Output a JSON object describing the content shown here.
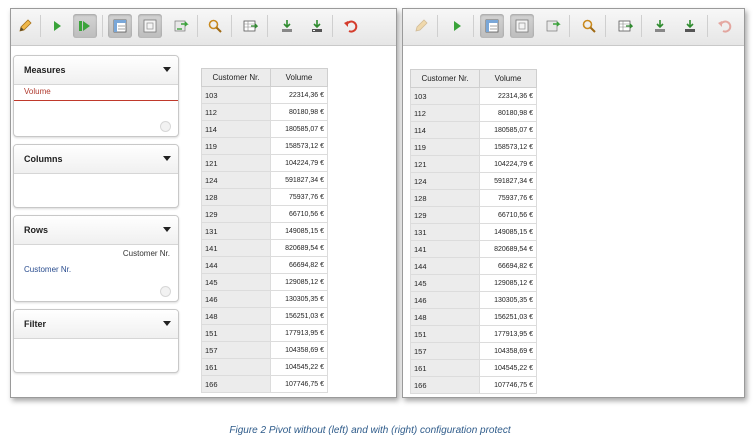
{
  "left_panel": {
    "sidebar": {
      "measures": {
        "title": "Measures",
        "items": [
          "Volume"
        ]
      },
      "columns": {
        "title": "Columns"
      },
      "rows": {
        "title": "Rows",
        "header_label": "Customer Nr.",
        "items": [
          "Customer Nr."
        ]
      },
      "filter": {
        "title": "Filter"
      }
    },
    "table": {
      "headers": [
        "Customer Nr.",
        "Volume"
      ],
      "rows": [
        [
          "103",
          "22314,36 €"
        ],
        [
          "112",
          "80180,98 €"
        ],
        [
          "114",
          "180585,07 €"
        ],
        [
          "119",
          "158573,12 €"
        ],
        [
          "121",
          "104224,79 €"
        ],
        [
          "124",
          "591827,34 €"
        ],
        [
          "128",
          "75937,76 €"
        ],
        [
          "129",
          "66710,56 €"
        ],
        [
          "131",
          "149085,15 €"
        ],
        [
          "141",
          "820689,54 €"
        ],
        [
          "144",
          "66694,82 €"
        ],
        [
          "145",
          "129085,12 €"
        ],
        [
          "146",
          "130305,35 €"
        ],
        [
          "148",
          "156251,03 €"
        ],
        [
          "151",
          "177913,95 €"
        ],
        [
          "157",
          "104358,69 €"
        ],
        [
          "161",
          "104545,22 €"
        ],
        [
          "166",
          "107746,75 €"
        ]
      ]
    }
  },
  "right_panel": {
    "table": {
      "headers": [
        "Customer Nr.",
        "Volume"
      ],
      "rows": [
        [
          "103",
          "22314,36 €"
        ],
        [
          "112",
          "80180,98 €"
        ],
        [
          "114",
          "180585,07 €"
        ],
        [
          "119",
          "158573,12 €"
        ],
        [
          "121",
          "104224,79 €"
        ],
        [
          "124",
          "591827,34 €"
        ],
        [
          "128",
          "75937,76 €"
        ],
        [
          "129",
          "66710,56 €"
        ],
        [
          "131",
          "149085,15 €"
        ],
        [
          "141",
          "820689,54 €"
        ],
        [
          "144",
          "66694,82 €"
        ],
        [
          "145",
          "129085,12 €"
        ],
        [
          "146",
          "130305,35 €"
        ],
        [
          "148",
          "156251,03 €"
        ],
        [
          "151",
          "177913,95 €"
        ],
        [
          "157",
          "104358,69 €"
        ],
        [
          "161",
          "104545,22 €"
        ],
        [
          "166",
          "107746,75 €"
        ]
      ]
    }
  },
  "toolbar_icons": [
    "edit-pencil-icon",
    "run-icon",
    "run-auto-icon",
    "pivot-layout-icon",
    "hide-icon",
    "swap-icon",
    "search-icon",
    "export-excel-icon",
    "download-icon",
    "download-alt-icon",
    "undo-icon"
  ],
  "colors": {
    "accent_red": "#b03a2e",
    "link_blue": "#2a4d8f",
    "caption_blue": "#2e5b8a"
  },
  "caption": "Figure 2 Pivot without (left) and with (right) configuration protect"
}
